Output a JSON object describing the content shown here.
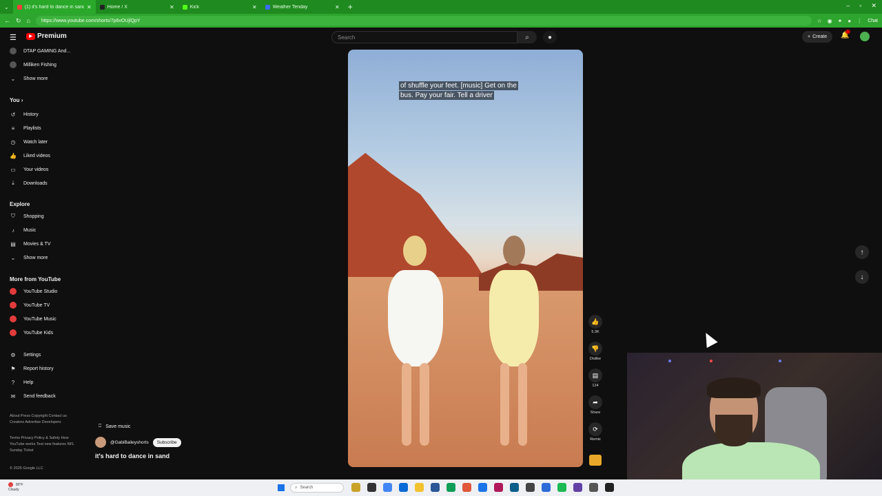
{
  "browser": {
    "tabs": [
      {
        "title": "(1) it's hard to dance in sand",
        "active": true,
        "favicon_color": "#ff3b3b"
      },
      {
        "title": "Home / X",
        "active": false,
        "favicon_color": "#222222"
      },
      {
        "title": "Kick",
        "active": false,
        "favicon_color": "#53fc18"
      },
      {
        "title": "Weather Tenday",
        "active": false,
        "favicon_color": "#3b6cff"
      }
    ],
    "url": "https://www.youtube.com/shorts/7p6vOUjlQpY",
    "chat_label": "Chat"
  },
  "youtube": {
    "logo_text": "Premium",
    "search_placeholder": "Search",
    "create_label": "Create",
    "notif_count": "9+"
  },
  "sidebar": {
    "subscriptions": [
      {
        "label": "DTAP GAMING And..."
      },
      {
        "label": "Milliken Fishing"
      }
    ],
    "show_more_1": "Show more",
    "you_header": "You",
    "you_items": [
      {
        "label": "History",
        "icon": "history-icon"
      },
      {
        "label": "Playlists",
        "icon": "playlist-icon"
      },
      {
        "label": "Watch later",
        "icon": "clock-icon"
      },
      {
        "label": "Liked videos",
        "icon": "thumbs-up-icon"
      },
      {
        "label": "Your videos",
        "icon": "video-icon"
      },
      {
        "label": "Downloads",
        "icon": "download-icon"
      }
    ],
    "explore_header": "Explore",
    "explore_items": [
      {
        "label": "Shopping",
        "icon": "shopping-bag-icon"
      },
      {
        "label": "Music",
        "icon": "music-note-icon"
      },
      {
        "label": "Movies & TV",
        "icon": "film-icon"
      }
    ],
    "show_more_2": "Show more",
    "more_header": "More from YouTube",
    "more_items": [
      {
        "label": "YouTube Studio"
      },
      {
        "label": "YouTube TV"
      },
      {
        "label": "YouTube Music"
      },
      {
        "label": "YouTube Kids"
      }
    ],
    "settings_items": [
      {
        "label": "Settings",
        "icon": "gear-icon"
      },
      {
        "label": "Report history",
        "icon": "flag-icon"
      },
      {
        "label": "Help",
        "icon": "help-icon"
      },
      {
        "label": "Send feedback",
        "icon": "feedback-icon"
      }
    ],
    "footer_1": "About  Press  Copyright  Contact us  Creators  Advertise  Developers",
    "footer_2": "Terms  Privacy  Policy & Safety  How YouTube works  Test new features  NFL Sunday Ticket",
    "copyright": "© 2025 Google LLC"
  },
  "short": {
    "caption_line1": "of shuffle your feet. [music] Get on the",
    "caption_line2": "bus. Pay your fair. Tell a driver",
    "save_music": "Save music",
    "channel": "@GabiBaileyshorts",
    "subscribe": "Subscribe",
    "title": "it's hard to dance in sand",
    "likes": "5.3K",
    "dislike": "Dislike",
    "comments": "124",
    "share": "Share",
    "remix": "Remix"
  },
  "taskbar": {
    "temp": "80°F",
    "condition": "Cloudy",
    "search": "Search"
  }
}
